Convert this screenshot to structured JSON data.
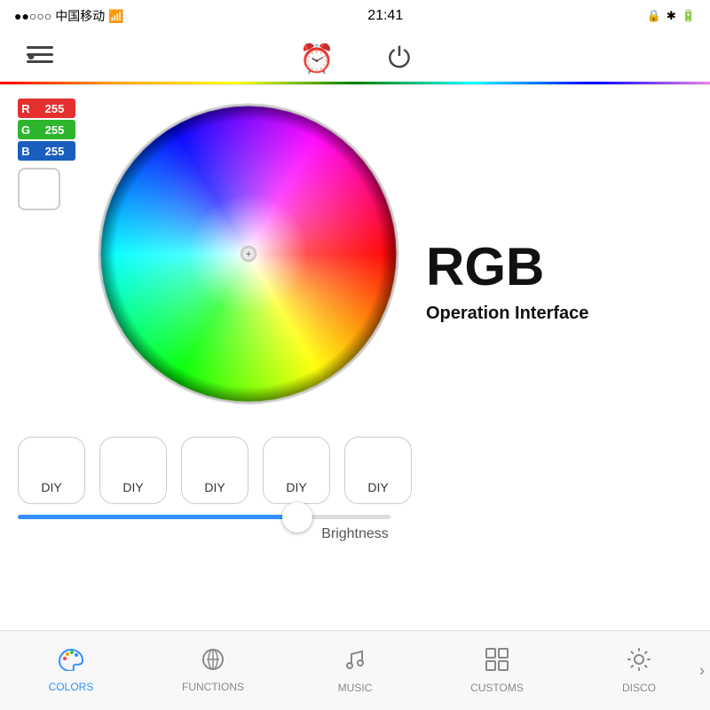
{
  "status_bar": {
    "carrier": "●●○○○ 中国移动 ✦",
    "time": "21:41",
    "icons": "⊕ ✪ ⬤"
  },
  "nav": {
    "menu_icon": "≡",
    "alarm_icon": "⏰",
    "power_icon": "⏻"
  },
  "rgb": {
    "r_label": "R",
    "g_label": "G",
    "b_label": "B",
    "r_value": "255",
    "g_value": "255",
    "b_value": "255"
  },
  "main": {
    "title": "RGB",
    "subtitle": "Operation Interface"
  },
  "diy_buttons": [
    {
      "label": "DIY"
    },
    {
      "label": "DIY"
    },
    {
      "label": "DIY"
    },
    {
      "label": "DIY"
    },
    {
      "label": "DIY"
    }
  ],
  "brightness": {
    "label": "Brightness",
    "value": 75
  },
  "tabs": [
    {
      "label": "COLORS",
      "icon": "colors",
      "active": true
    },
    {
      "label": "FUNCTIONS",
      "icon": "functions",
      "active": false
    },
    {
      "label": "MUSIC",
      "icon": "music",
      "active": false
    },
    {
      "label": "CUSTOMS",
      "icon": "customs",
      "active": false
    },
    {
      "label": "DISCO",
      "icon": "disco",
      "active": false
    }
  ],
  "colors": {
    "accent": "#3390ff"
  }
}
